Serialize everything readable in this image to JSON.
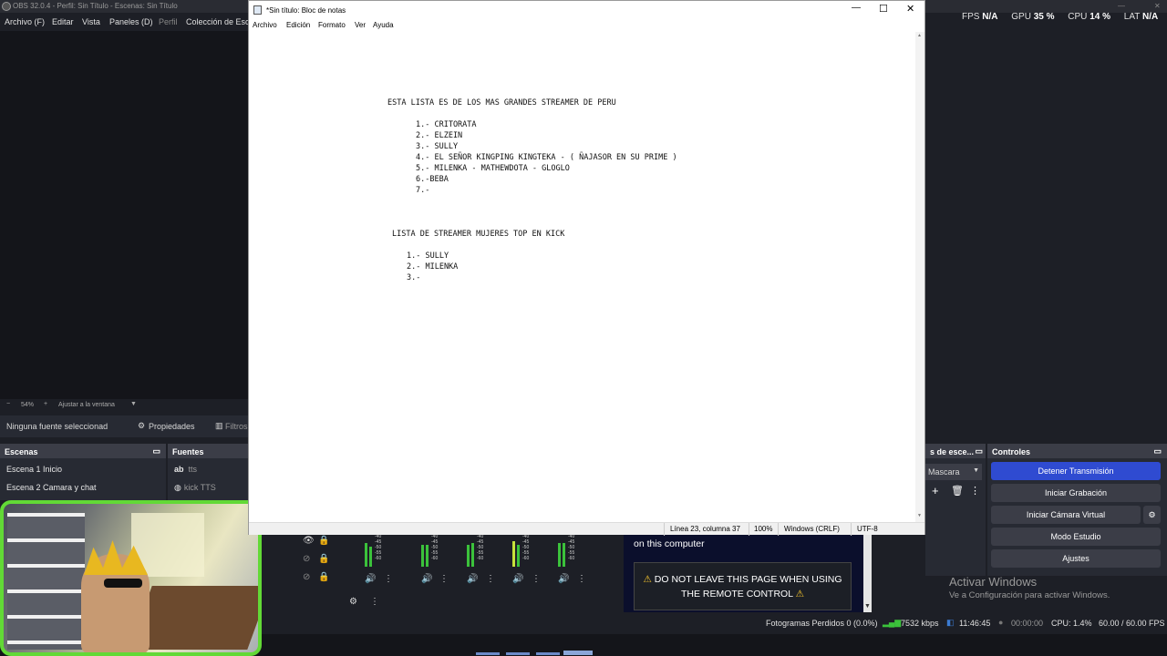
{
  "obs": {
    "title": "OBS 32.0.4 - Perfil: Sin Título - Escenas: Sin Título",
    "menu": [
      "Archivo (F)",
      "Editar",
      "Vista",
      "Paneles (D)",
      "Perfil",
      "Colección de Esc"
    ],
    "stats": {
      "fps_label": "FPS",
      "fps_value": "N/A",
      "gpu_label": "GPU",
      "gpu_value": "35 %",
      "cpu_label": "CPU",
      "cpu_value": "14 %",
      "lat_label": "LAT",
      "lat_value": "N/A"
    },
    "zoom": {
      "minus": "−",
      "value": "54%",
      "plus": "+",
      "fit": "Ajustar a la ventana"
    },
    "source_toolbar": {
      "no_source": "Ninguna fuente seleccionad",
      "properties": "Propiedades",
      "filters": "Filtros"
    },
    "scenes": {
      "title": "Escenas",
      "items": [
        "Escena 1 Inicio",
        "Escena 2 Camara y chat"
      ]
    },
    "sources": {
      "title": "Fuentes",
      "items": [
        {
          "prefix": "ab",
          "label": "tts"
        },
        {
          "prefix": "",
          "label": "kick TTS"
        }
      ]
    },
    "transitions": {
      "title": "s de esce...",
      "selected": "Mascara"
    },
    "controls": {
      "title": "Controles",
      "buttons": [
        "Detener Transmisión",
        "Iniciar Grabación",
        "Iniciar Cámara Virtual",
        "Modo Estudio",
        "Ajustes"
      ],
      "accent": "#2f4bd1"
    },
    "mixer": {
      "scale": [
        "-40",
        "-45",
        "-50",
        "-55",
        "-60"
      ]
    },
    "remote": {
      "text": "on this computer",
      "warning_line1": "DO NOT LEAVE THIS PAGE WHEN USING",
      "warning_line2": "THE REMOTE CONTROL"
    },
    "status": {
      "dropped": "Fotogramas Perdidos 0 (0.0%)",
      "bitrate": "7532 kbps",
      "stream_time": "11:46:45",
      "rec_time": "00:00:00",
      "cpu": "CPU: 1.4%",
      "fps": "60.00 / 60.00 FPS"
    }
  },
  "activate_windows": {
    "title": "Activar Windows",
    "subtitle": "Ve a Configuración para activar Windows."
  },
  "notepad": {
    "title": "*Sin título: Bloc de notas",
    "menu": [
      "Archivo",
      "Edición",
      "Formato",
      "Ver",
      "Ayuda"
    ],
    "lines": [
      "ESTA LISTA ES DE LOS MAS GRANDES STREAMER DE PERU",
      "1.- CRITORATA",
      "2.- ELZEIN",
      "3.- SULLY",
      "4.- EL SEÑOR KINGPING KINGTEKA - ( ÑAJASOR EN SU PRIME )",
      "5.- MILENKA - MATHEWDOTA - GLOGLO",
      "6.-BEBA",
      "7.-",
      "LISTA DE STREAMER MUJERES TOP EN KICK",
      "1.- SULLY",
      "2.- MILENKA",
      "3.-"
    ],
    "status": {
      "position": "Línea 23, columna 37",
      "zoom": "100%",
      "eol": "Windows (CRLF)",
      "encoding": "UTF-8"
    }
  }
}
